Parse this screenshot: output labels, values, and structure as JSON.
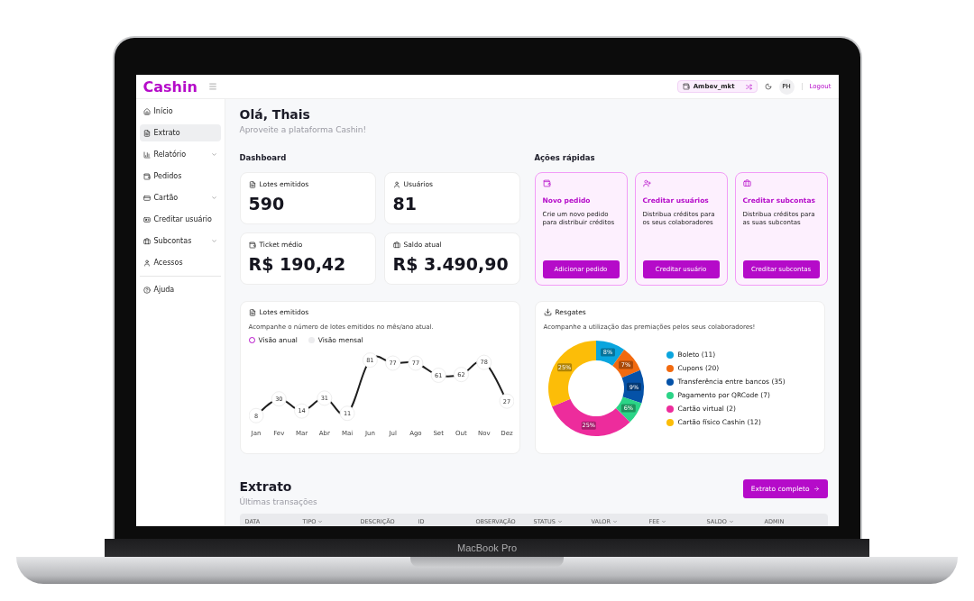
{
  "laptop": {
    "label": "MacBook Pro"
  },
  "header": {
    "logo": "Cashin",
    "account": "Ambev_mkt",
    "avatar": "PH",
    "logout": "Logout"
  },
  "sidebar": {
    "items": [
      {
        "label": "Início",
        "selected": false,
        "has_submenu": false
      },
      {
        "label": "Extrato",
        "selected": true,
        "has_submenu": false
      },
      {
        "label": "Relatório",
        "selected": false,
        "has_submenu": true
      },
      {
        "label": "Pedidos",
        "selected": false,
        "has_submenu": false
      },
      {
        "label": "Cartão",
        "selected": false,
        "has_submenu": true
      },
      {
        "label": "Creditar usuário",
        "selected": false,
        "has_submenu": false
      },
      {
        "label": "Subcontas",
        "selected": false,
        "has_submenu": true
      },
      {
        "label": "Acessos",
        "selected": false,
        "has_submenu": false
      }
    ],
    "footer_items": [
      {
        "label": "Ajuda",
        "selected": false
      }
    ]
  },
  "greeting": {
    "title": "Olá, Thais",
    "subtitle": "Aproveite a plataforma Cashin!"
  },
  "dashboard": {
    "title": "Dashboard",
    "stats": [
      {
        "label": "Lotes emitidos",
        "value": "590"
      },
      {
        "label": "Usuários",
        "value": "81"
      },
      {
        "label": "Ticket médio",
        "value": "R$ 190,42"
      },
      {
        "label": "Saldo atual",
        "value": "R$ 3.490,90"
      }
    ]
  },
  "quick_actions": {
    "title": "Ações rápidas",
    "cards": [
      {
        "title": "Novo pedido",
        "description": "Crie um novo pedido para distribuir créditos",
        "button": "Adicionar pedido"
      },
      {
        "title": "Creditar usuários",
        "description": "Distribua créditos para os seus colaboradores",
        "button": "Creditar usuário"
      },
      {
        "title": "Creditar subcontas",
        "description": "Distribua créditos para as suas subcontas",
        "button": "Creditar subcontas"
      }
    ]
  },
  "lotes_chart": {
    "title": "Lotes emitidos",
    "description": "Acompanhe o número de lotes emitidos no mês/ano atual.",
    "views": [
      {
        "label": "Visão anual",
        "selected": true
      },
      {
        "label": "Visão mensal",
        "selected": false
      }
    ],
    "chart_data": {
      "type": "line",
      "categories": [
        "Jan",
        "Fev",
        "Mar",
        "Abr",
        "Mai",
        "Jun",
        "Jul",
        "Ago",
        "Set",
        "Out",
        "Nov",
        "Dez"
      ],
      "series": [
        {
          "color": "#1e1e1e",
          "marker": true,
          "values": [
            8,
            30,
            14,
            31,
            11,
            81,
            77,
            77,
            61,
            62,
            78,
            27
          ]
        }
      ],
      "data_labels": true
    }
  },
  "resgates": {
    "title": "Resgates",
    "description": "Acompanhe a utilização das premiações pelos seus colaboradores!",
    "legend": [
      {
        "label": "Boleto (11)",
        "color": "#0aa5de"
      },
      {
        "label": "Cupons (20)",
        "color": "#f26a0f"
      },
      {
        "label": "Transferência entre bancos (35)",
        "color": "#0552a8"
      },
      {
        "label": "Pagamento por QRCode (7)",
        "color": "#2bd487"
      },
      {
        "label": "Cartão virtual (2)",
        "color": "#ed2c9c"
      },
      {
        "label": "Cartão físico Cashin (12)",
        "color": "#fcbd08"
      }
    ],
    "chart_data": {
      "type": "donut",
      "values": [
        8,
        7,
        9,
        6,
        25,
        25
      ],
      "value_labels": [
        "8%",
        "7%",
        "9%",
        "6%",
        "25%",
        "25%"
      ]
    }
  },
  "extrato": {
    "title": "Extrato",
    "subtitle": "Últimas transações",
    "button": "Extrato completo",
    "columns": [
      {
        "label": "DATA",
        "sortable": false
      },
      {
        "label": "TIPO",
        "sortable": true
      },
      {
        "label": "DESCRIÇÃO",
        "sortable": false
      },
      {
        "label": "ID",
        "sortable": false
      },
      {
        "label": "OBSERVAÇÃO",
        "sortable": false
      },
      {
        "label": "STATUS",
        "sortable": true
      },
      {
        "label": "VALOR",
        "sortable": true
      },
      {
        "label": "FEE",
        "sortable": true
      },
      {
        "label": "SALDO",
        "sortable": true
      },
      {
        "label": "ADMIN",
        "sortable": false
      }
    ]
  }
}
